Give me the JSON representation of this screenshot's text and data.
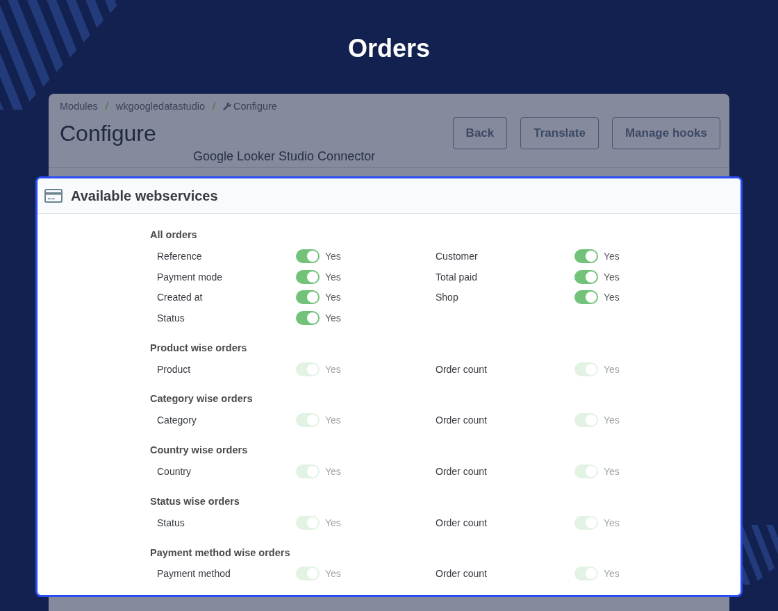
{
  "page_title": "Orders",
  "breadcrumb": {
    "separator": "/",
    "items": [
      {
        "label": "Modules",
        "icon": false
      },
      {
        "label": "wkgoogledatastudio",
        "icon": false
      },
      {
        "label": "Configure",
        "icon": true
      }
    ]
  },
  "header": {
    "title": "Configure",
    "subtitle": "Google Looker Studio Connector",
    "buttons": [
      "Back",
      "Translate",
      "Manage hooks"
    ]
  },
  "card": {
    "title": "Available webservices",
    "sections": [
      {
        "title": "All orders",
        "fields": [
          {
            "label": "Reference",
            "on": true,
            "disabled": false,
            "state_label": "Yes"
          },
          {
            "label": "Customer",
            "on": true,
            "disabled": false,
            "state_label": "Yes"
          },
          {
            "label": "Payment mode",
            "on": true,
            "disabled": false,
            "state_label": "Yes"
          },
          {
            "label": "Total paid",
            "on": true,
            "disabled": false,
            "state_label": "Yes"
          },
          {
            "label": "Created at",
            "on": true,
            "disabled": false,
            "state_label": "Yes"
          },
          {
            "label": "Shop",
            "on": true,
            "disabled": false,
            "state_label": "Yes"
          },
          {
            "label": "Status",
            "on": true,
            "disabled": false,
            "state_label": "Yes"
          }
        ]
      },
      {
        "title": "Product wise orders",
        "fields": [
          {
            "label": "Product",
            "on": true,
            "disabled": true,
            "state_label": "Yes"
          },
          {
            "label": "Order count",
            "on": true,
            "disabled": true,
            "state_label": "Yes"
          }
        ]
      },
      {
        "title": "Category wise orders",
        "fields": [
          {
            "label": "Category",
            "on": true,
            "disabled": true,
            "state_label": "Yes"
          },
          {
            "label": "Order count",
            "on": true,
            "disabled": true,
            "state_label": "Yes"
          }
        ]
      },
      {
        "title": "Country wise orders",
        "fields": [
          {
            "label": "Country",
            "on": true,
            "disabled": true,
            "state_label": "Yes"
          },
          {
            "label": "Order count",
            "on": true,
            "disabled": true,
            "state_label": "Yes"
          }
        ]
      },
      {
        "title": "Status wise orders",
        "fields": [
          {
            "label": "Status",
            "on": true,
            "disabled": true,
            "state_label": "Yes"
          },
          {
            "label": "Order count",
            "on": true,
            "disabled": true,
            "state_label": "Yes"
          }
        ]
      },
      {
        "title": "Payment method wise orders",
        "fields": [
          {
            "label": "Payment method",
            "on": true,
            "disabled": true,
            "state_label": "Yes"
          },
          {
            "label": "Order count",
            "on": true,
            "disabled": true,
            "state_label": "Yes"
          }
        ]
      }
    ]
  }
}
